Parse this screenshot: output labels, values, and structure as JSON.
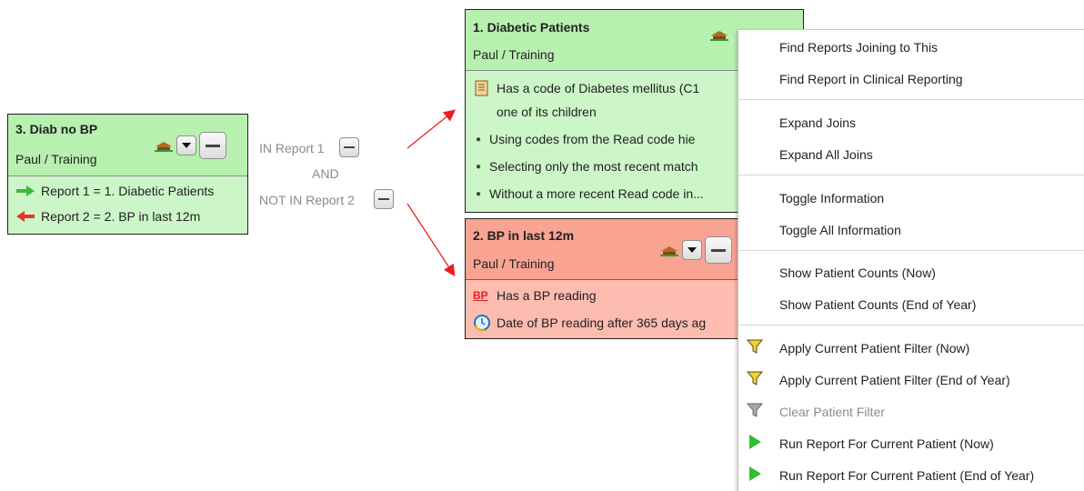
{
  "report3": {
    "title": "3. Diab no BP",
    "owner": "Paul / Training",
    "rows": [
      "Report 1 = 1. Diabetic Patients",
      "Report 2 = 2. BP in last 12m"
    ]
  },
  "join": {
    "in_label": "IN Report 1",
    "and_label": "AND",
    "not_in_label": "NOT IN Report 2"
  },
  "report1": {
    "title": "1. Diabetic Patients",
    "owner": "Paul / Training",
    "rows": [
      "Has a code of Diabetes mellitus (C1",
      "one of its children",
      "Using codes from the Read code hie",
      "Selecting only the most recent match",
      "Without a more recent Read code in..."
    ]
  },
  "report2": {
    "title": "2. BP in last 12m",
    "owner": "Paul / Training",
    "bp_badge": "BP",
    "rows": [
      "Has a BP reading",
      "Date of BP reading after 365 days ag"
    ]
  },
  "colors": {
    "green_card": "#ccf5c8",
    "red_card": "#fcbcb0",
    "arrow_red": "#e82020",
    "arrow_green": "#3cb83c"
  },
  "context_menu": {
    "items": [
      {
        "label": "Find Reports Joining to This"
      },
      {
        "label": "Find Report in Clinical Reporting"
      },
      {
        "label": "Expand Joins"
      },
      {
        "label": "Expand All Joins"
      },
      {
        "label": "Toggle Information"
      },
      {
        "label": "Toggle All Information"
      },
      {
        "label": "Show Patient Counts (Now)"
      },
      {
        "label": "Show Patient Counts (End of Year)"
      },
      {
        "label": "Apply Current Patient Filter (Now)",
        "icon": "funnel-yellow-icon"
      },
      {
        "label": "Apply Current Patient Filter (End of Year)",
        "icon": "funnel-yellow-icon"
      },
      {
        "label": "Clear Patient Filter",
        "icon": "funnel-grey-icon",
        "disabled": true
      },
      {
        "label": "Run Report For Current Patient (Now)",
        "icon": "play-green-icon"
      },
      {
        "label": "Run Report For Current Patient (End of Year)",
        "icon": "play-green-icon"
      }
    ]
  }
}
